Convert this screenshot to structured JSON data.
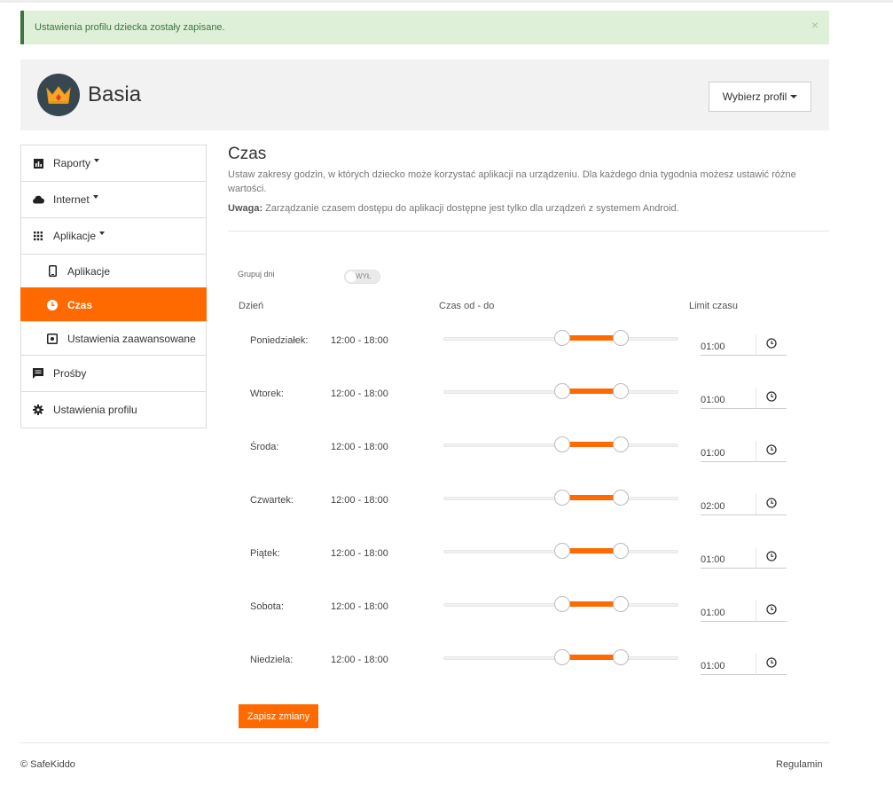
{
  "alert": {
    "message": "Ustawienia profilu dziecka zostały zapisane.",
    "close": "×"
  },
  "profile": {
    "name": "Basia",
    "select_label": "Wybierz profil"
  },
  "sidebar": {
    "items": [
      {
        "label": "Raporty",
        "icon": "bar-chart-icon"
      },
      {
        "label": "Internet",
        "icon": "cloud-icon"
      },
      {
        "label": "Aplikacje",
        "icon": "apps-grid-icon"
      },
      {
        "label": "Aplikacje",
        "icon": "phone-icon"
      },
      {
        "label": "Czas",
        "icon": "clock-icon"
      },
      {
        "label": "Ustawienia zaawansowane",
        "icon": "advanced-settings-icon"
      },
      {
        "label": "Prośby",
        "icon": "message-icon"
      },
      {
        "label": "Ustawienia profilu",
        "icon": "gear-icon"
      }
    ]
  },
  "content": {
    "title": "Czas",
    "description": "Ustaw zakresy godzin, w których dziecko może korzystać aplikacji na urządzeniu. Dla każdego dnia tygodnia możesz ustawić różne wartości.",
    "note_label": "Uwaga:",
    "note_text": " Zarządzanie czasem dostępu do aplikacji dostępne jest tylko dla urządzeń z systemem Android.",
    "group_days_label": "Grupuj dni",
    "group_days_toggle": "WYŁ",
    "columns": {
      "day": "Dzień",
      "time": "Czas od - do",
      "limit": "Limit czasu"
    },
    "save_button": "Zapisz zmiany"
  },
  "schedule": [
    {
      "day": "Poniedziałek:",
      "range": "12:00 - 18:00",
      "from_h": 12,
      "to_h": 18,
      "limit": "01:00"
    },
    {
      "day": "Wtorek:",
      "range": "12:00 - 18:00",
      "from_h": 12,
      "to_h": 18,
      "limit": "01:00"
    },
    {
      "day": "Środa:",
      "range": "12:00 - 18:00",
      "from_h": 12,
      "to_h": 18,
      "limit": "01:00"
    },
    {
      "day": "Czwartek:",
      "range": "12:00 - 18:00",
      "from_h": 12,
      "to_h": 18,
      "limit": "02:00"
    },
    {
      "day": "Piątek:",
      "range": "12:00 - 18:00",
      "from_h": 12,
      "to_h": 18,
      "limit": "01:00"
    },
    {
      "day": "Sobota:",
      "range": "12:00 - 18:00",
      "from_h": 12,
      "to_h": 18,
      "limit": "01:00"
    },
    {
      "day": "Niedziela:",
      "range": "12:00 - 18:00",
      "from_h": 12,
      "to_h": 18,
      "limit": "01:00"
    }
  ],
  "footer": {
    "copyright": "© SafeKiddo",
    "terms": "Regulamin"
  },
  "colors": {
    "accent": "#ff6a00",
    "alert_bg": "#dff0d8",
    "alert_text": "#3c763d"
  }
}
